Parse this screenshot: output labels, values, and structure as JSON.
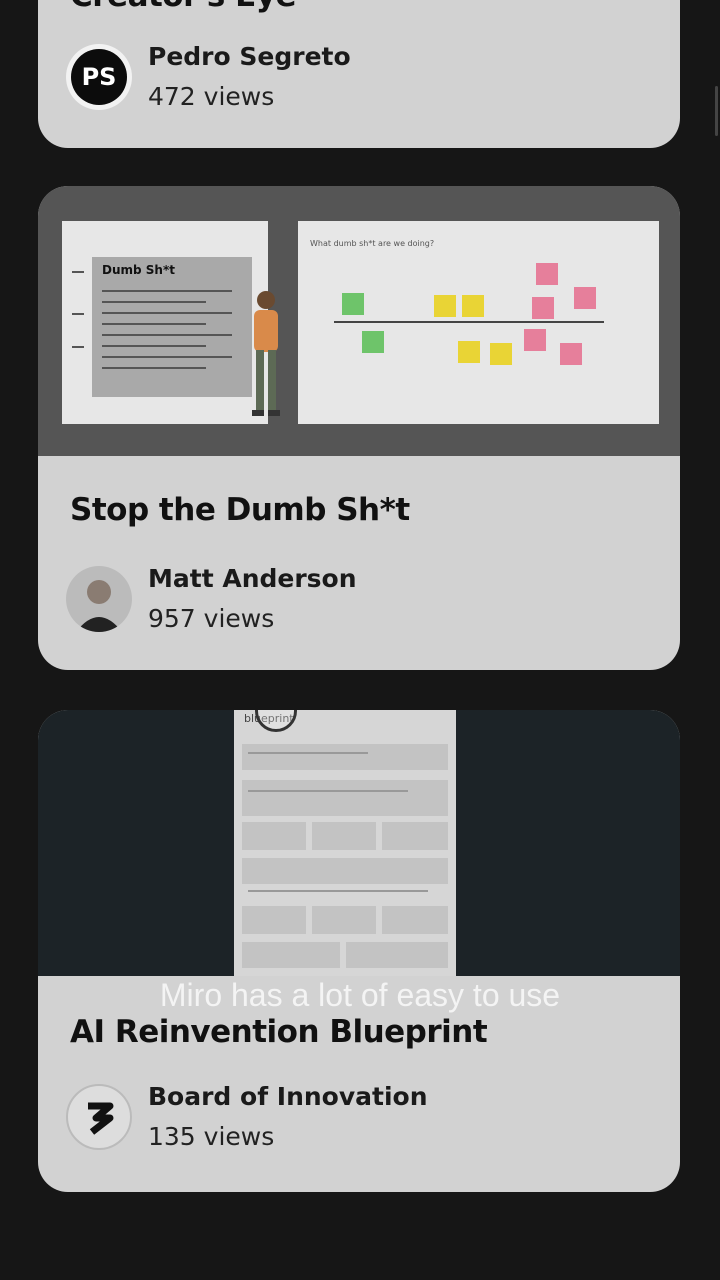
{
  "cards": [
    {
      "title": "Creator's Eye",
      "author": "Pedro Segreto",
      "avatar_initials": "PS",
      "views": "472 views"
    },
    {
      "title": "Stop the Dumb Sh*t",
      "author": "Matt Anderson",
      "views": "957 views",
      "thumbnail": {
        "left_slide_title": "Dumb Sh*t",
        "right_slide_title": "What dumb sh*t are we doing?"
      }
    },
    {
      "title": "AI Reinvention Blueprint",
      "author": "Board of Innovation",
      "views": "135 views",
      "thumbnail": {
        "doc_label": "blueprint"
      }
    }
  ],
  "caption": "Miro has a lot of easy to use",
  "colors": {
    "background": "#161616",
    "card": "#d2d2d2",
    "sticky_green": "#6ec46a",
    "sticky_yellow": "#e9d435",
    "sticky_pink": "#e67f9b"
  }
}
